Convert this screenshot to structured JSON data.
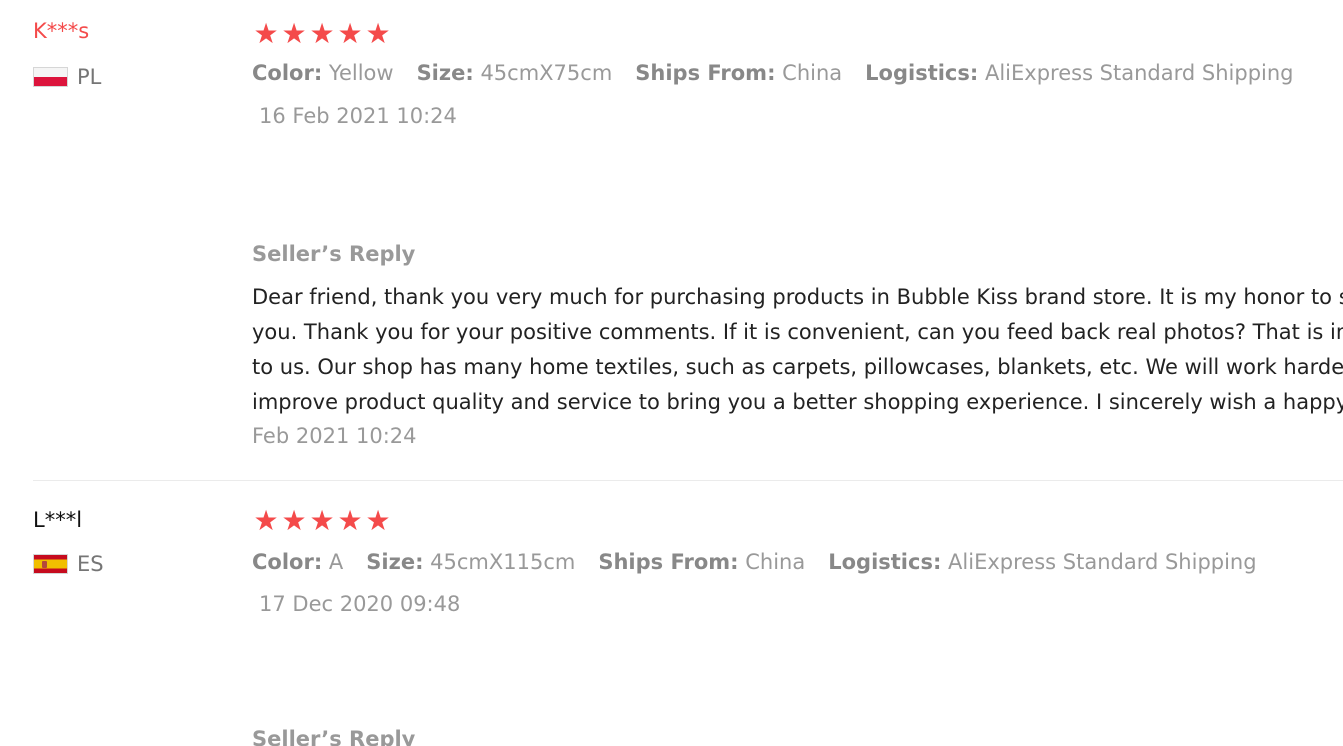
{
  "reviews": [
    {
      "user_name": "K***s",
      "country": "PL",
      "flag_icon": "poland-flag-icon",
      "rating": 5,
      "stars": [
        "★",
        "★",
        "★",
        "★",
        "★"
      ],
      "sku": [
        {
          "key": "Color:",
          "value": "Yellow"
        },
        {
          "key": "Size:",
          "value": "45cmX75cm"
        },
        {
          "key": "Ships From:",
          "value": "China"
        },
        {
          "key": "Logistics:",
          "value": "AliExpress Standard Shipping"
        }
      ],
      "date": "16 Feb 2021 10:24",
      "seller_reply": {
        "title": "Seller’s Reply",
        "lines": [
          "Dear friend, thank you very much for purchasing products in Bubble Kiss brand store. It is my honor to s",
          "you. Thank you for your positive comments. If it is convenient, can you feed back real photos? That is im",
          "to us. Our shop has many home textiles, such as carpets, pillowcases, blankets, etc. We will work harder",
          "improve product quality and service to bring you a better shopping experience. I sincerely wish a happy"
        ],
        "date": "Feb 2021 10:24"
      }
    },
    {
      "user_name": "L***l",
      "country": "ES",
      "flag_icon": "spain-flag-icon",
      "rating": 5,
      "stars": [
        "★",
        "★",
        "★",
        "★",
        "★"
      ],
      "sku": [
        {
          "key": "Color:",
          "value": "A"
        },
        {
          "key": "Size:",
          "value": "45cmX115cm"
        },
        {
          "key": "Ships From:",
          "value": "China"
        },
        {
          "key": "Logistics:",
          "value": "AliExpress Standard Shipping"
        }
      ],
      "date": "17 Dec 2020 09:48",
      "seller_reply": {
        "title": "Seller’s Reply"
      }
    }
  ],
  "colors": {
    "accent_red": "#f44a4a",
    "muted_text": "#999999",
    "body_text": "#222222"
  }
}
